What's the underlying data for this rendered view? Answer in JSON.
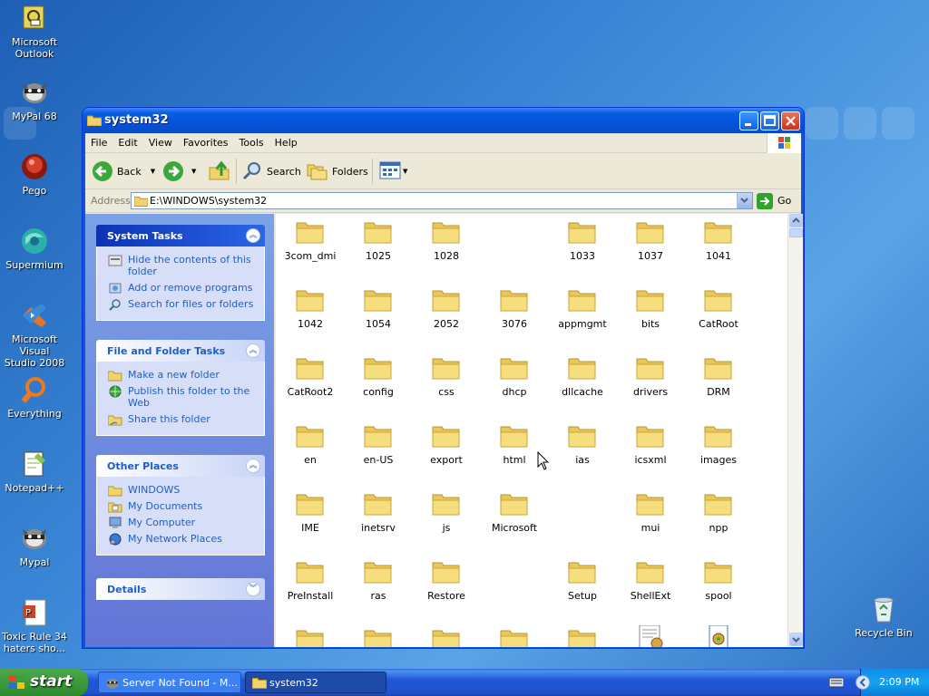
{
  "desktop": {
    "icons": [
      {
        "label": "Microsoft\nOutlook",
        "icon": "outlook-icon"
      },
      {
        "label": "MyPal 68",
        "icon": "raccoon-icon"
      },
      {
        "label": "Pego",
        "icon": "pego-icon"
      },
      {
        "label": "Supermium",
        "icon": "supermium-icon"
      },
      {
        "label": "Microsoft Visual\nStudio 2008",
        "icon": "visual-studio-icon"
      },
      {
        "label": "Everything",
        "icon": "search-ring-icon"
      },
      {
        "label": "Notepad++",
        "icon": "notepadpp-icon"
      },
      {
        "label": "Mypal",
        "icon": "raccoon-icon"
      },
      {
        "label": "Toxic Rule 34\nhaters sho...",
        "icon": "powerpoint-file-icon"
      }
    ],
    "recycle_bin": "Recycle Bin"
  },
  "window": {
    "title": "system32",
    "menu": [
      "File",
      "Edit",
      "View",
      "Favorites",
      "Tools",
      "Help"
    ],
    "toolbar": {
      "back": "Back",
      "search": "Search",
      "folders": "Folders"
    },
    "address": {
      "label": "Address",
      "value": "E:\\WINDOWS\\system32",
      "go": "Go"
    },
    "taskpane": {
      "system_tasks": {
        "title": "System Tasks",
        "items": [
          "Hide the contents of this folder",
          "Add or remove programs",
          "Search for files or folders"
        ]
      },
      "file_folder_tasks": {
        "title": "File and Folder Tasks",
        "items": [
          "Make a new folder",
          "Publish this folder to the Web",
          "Share this folder"
        ]
      },
      "other_places": {
        "title": "Other Places",
        "items": [
          "WINDOWS",
          "My Documents",
          "My Computer",
          "My Network Places"
        ]
      },
      "details": {
        "title": "Details"
      }
    },
    "files": [
      [
        "3com_dmi",
        "1025",
        "1028",
        "",
        "1033",
        "1037",
        "1041"
      ],
      [
        "1042",
        "1054",
        "2052",
        "3076",
        "appmgmt",
        "bits",
        "CatRoot"
      ],
      [
        "CatRoot2",
        "config",
        "css",
        "dhcp",
        "dllcache",
        "drivers",
        "DRM"
      ],
      [
        "en",
        "en-US",
        "export",
        "html",
        "ias",
        "icsxml",
        "images"
      ],
      [
        "IME",
        "inetsrv",
        "js",
        "Microsoft",
        "",
        "mui",
        "npp"
      ],
      [
        "PreInstall",
        "ras",
        "Restore",
        "",
        "Setup",
        "ShellExt",
        "spool"
      ]
    ]
  },
  "taskbar": {
    "start": "start",
    "items": [
      "Server Not Found - M...",
      "system32"
    ],
    "clock": "2:09 PM"
  }
}
